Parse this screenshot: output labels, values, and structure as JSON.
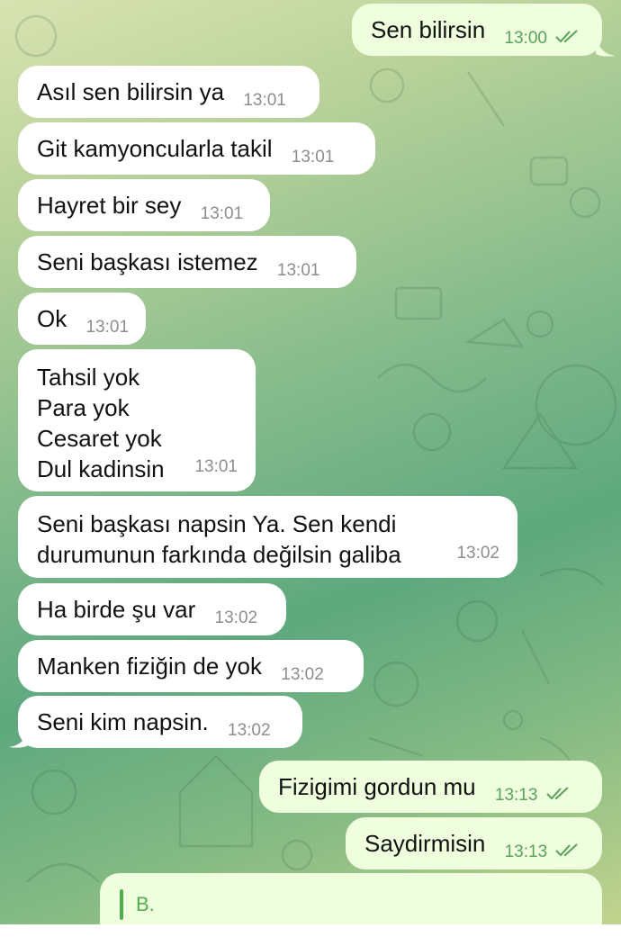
{
  "colors": {
    "incoming_bubble": "#ffffff",
    "outgoing_bubble": "#efffde",
    "outgoing_meta": "#5aa15b",
    "incoming_meta": "#8d8d8d"
  },
  "messages": [
    {
      "direction": "out",
      "text": "Sen bilirsin",
      "time": "13:00",
      "read": true
    },
    {
      "direction": "in",
      "text": "Asıl sen bilirsin ya",
      "time": "13:01"
    },
    {
      "direction": "in",
      "text": "Git kamyoncularla takil",
      "time": "13:01"
    },
    {
      "direction": "in",
      "text": "Hayret bir sey",
      "time": "13:01"
    },
    {
      "direction": "in",
      "text": "Seni başkası istemez",
      "time": "13:01"
    },
    {
      "direction": "in",
      "text": "Ok",
      "time": "13:01"
    },
    {
      "direction": "in",
      "text": "Tahsil yok\nPara yok\nCesaret yok\nDul kadinsin",
      "time": "13:01"
    },
    {
      "direction": "in",
      "text": "Seni başkası napsin Ya. Sen kendi\ndurumunun farkında değilsin galiba",
      "time": "13:02"
    },
    {
      "direction": "in",
      "text": "Ha birde şu var",
      "time": "13:02"
    },
    {
      "direction": "in",
      "text": "Manken fiziğin de yok",
      "time": "13:02"
    },
    {
      "direction": "in",
      "text": "Seni kim napsin.",
      "time": "13:02"
    },
    {
      "direction": "out",
      "text": "Fizigimi gordun mu",
      "time": "13:13",
      "read": true
    },
    {
      "direction": "out",
      "text": "Saydirmisin",
      "time": "13:13",
      "read": true
    }
  ],
  "reply_draft": {
    "name": "B."
  }
}
